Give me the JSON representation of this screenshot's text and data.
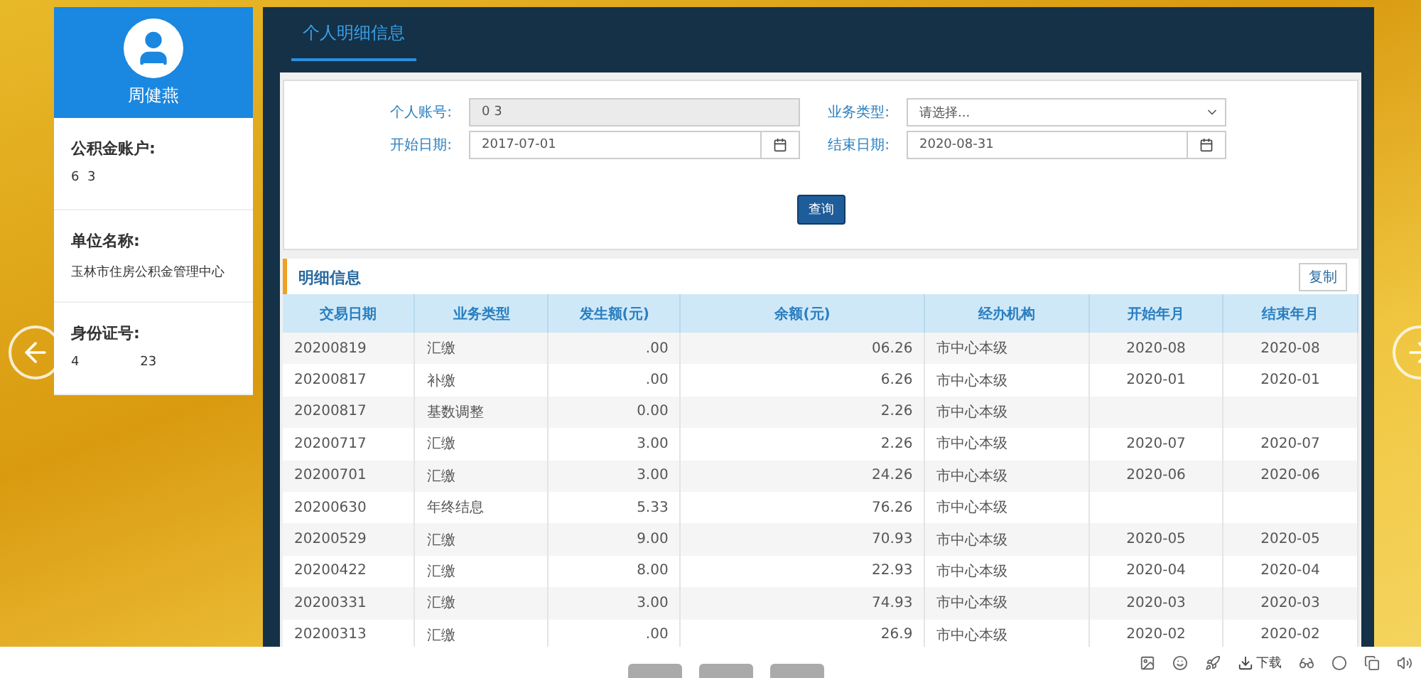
{
  "profile": {
    "name": "周健燕",
    "fields": [
      {
        "label": "公积金账户:",
        "value": "6  3"
      },
      {
        "label": "单位名称:",
        "value": "玉林市住房公积金管理中心"
      },
      {
        "label": "身份证号:",
        "value": "4               23"
      }
    ]
  },
  "panel": {
    "tab": {
      "label": "个人明细信息",
      "selected": true
    }
  },
  "form": {
    "account": {
      "label": "个人账号:",
      "value": "0  3",
      "disabled": true
    },
    "type": {
      "label": "业务类型:",
      "value": "请选择..."
    },
    "start": {
      "label": "开始日期:",
      "value": "2017-07-01"
    },
    "end": {
      "label": "结束日期:",
      "value": "2020-08-31"
    },
    "submit": "查询"
  },
  "detail": {
    "title": "明细信息",
    "copy": "复制",
    "columns": [
      "交易日期",
      "业务类型",
      "发生额(元)",
      "余额(元)",
      "经办机构",
      "开始年月",
      "结束年月"
    ],
    "rows": [
      [
        "20200819",
        "汇缴",
        ".00",
        "06.26",
        "市中心本级",
        "2020-08",
        "2020-08"
      ],
      [
        "20200817",
        "补缴",
        ".00",
        "6.26",
        "市中心本级",
        "2020-01",
        "2020-01"
      ],
      [
        "20200817",
        "基数调整",
        "0.00",
        "2.26",
        "市中心本级",
        "",
        ""
      ],
      [
        "20200717",
        "汇缴",
        "3.00",
        "2.26",
        "市中心本级",
        "2020-07",
        "2020-07"
      ],
      [
        "20200701",
        "汇缴",
        "3.00",
        "24.26",
        "市中心本级",
        "2020-06",
        "2020-06"
      ],
      [
        "20200630",
        "年终结息",
        "5.33",
        "76.26",
        "市中心本级",
        "",
        ""
      ],
      [
        "20200529",
        "汇缴",
        "9.00",
        "70.93",
        "市中心本级",
        "2020-05",
        "2020-05"
      ],
      [
        "20200422",
        "汇缴",
        "8.00",
        "22.93",
        "市中心本级",
        "2020-04",
        "2020-04"
      ],
      [
        "20200331",
        "汇缴",
        "3.00",
        "74.93",
        "市中心本级",
        "2020-03",
        "2020-03"
      ],
      [
        "20200313",
        "汇缴",
        ".00",
        "26.9",
        "市中心本级",
        "2020-02",
        "2020-02"
      ]
    ]
  },
  "viewer_toolbar": {
    "download": "下载"
  }
}
